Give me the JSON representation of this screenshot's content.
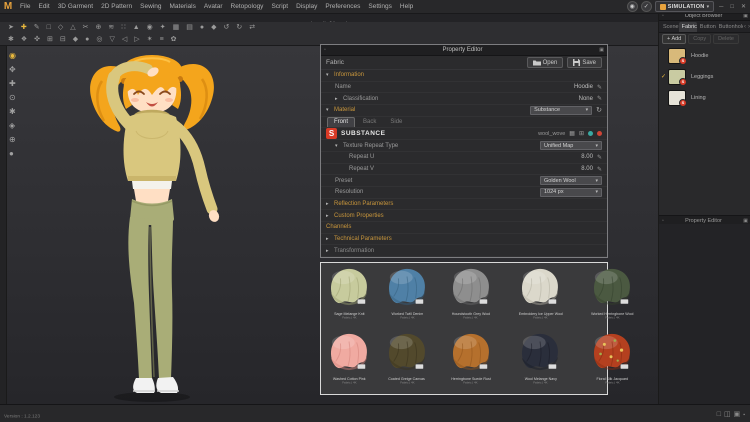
{
  "window": {
    "logo": "M",
    "menus": [
      "File",
      "Edit",
      "3D Garment",
      "2D Pattern",
      "Sewing",
      "Materials",
      "Avatar",
      "Retopology",
      "Script",
      "Display",
      "Preferences",
      "Settings",
      "Help"
    ],
    "document_tab": "hoodie01.zprj",
    "mode_label": "SIMULATION",
    "status_text": "Version : 1.2.123",
    "window_controls": [
      "─",
      "□",
      "✕"
    ],
    "account_icons": [
      {
        "name": "user-icon",
        "glyph": "◉"
      },
      {
        "name": "sync-check-icon",
        "glyph": "✓"
      }
    ]
  },
  "toolbar": {
    "row1": [
      {
        "name": "select-tool-icon",
        "glyph": "➤"
      },
      {
        "name": "add-tool-icon",
        "glyph": "✚"
      },
      {
        "name": "edit-pattern-icon",
        "glyph": "✎"
      },
      {
        "name": "rectangle-tool-icon",
        "glyph": "□"
      },
      {
        "name": "polygon-tool-icon",
        "glyph": "◇"
      },
      {
        "name": "curve-tool-icon",
        "glyph": "△"
      },
      {
        "name": "scissors-icon",
        "glyph": "✂"
      },
      {
        "name": "sew-tool-icon",
        "glyph": "⊕"
      },
      {
        "name": "free-sew-icon",
        "glyph": "≋"
      },
      {
        "name": "pin-tool-icon",
        "glyph": "∷"
      },
      {
        "name": "avatar-tool-icon",
        "glyph": "▲"
      },
      {
        "name": "target-icon",
        "glyph": "◉"
      },
      {
        "name": "sparkle-icon",
        "glyph": "✦"
      },
      {
        "name": "grid-icon",
        "glyph": "▦"
      },
      {
        "name": "layers-icon",
        "glyph": "▤"
      },
      {
        "name": "dot-icon",
        "glyph": "●"
      },
      {
        "name": "diamond-icon",
        "glyph": "◆"
      },
      {
        "name": "undo-icon",
        "glyph": "↺"
      },
      {
        "name": "redo-icon",
        "glyph": "↻"
      },
      {
        "name": "swap-icon",
        "glyph": "⇄"
      }
    ],
    "row2": [
      {
        "name": "asterisk-tool-icon",
        "glyph": "✱"
      },
      {
        "name": "ornament-tool-icon",
        "glyph": "❖"
      },
      {
        "name": "cross-tool-icon",
        "glyph": "✜"
      },
      {
        "name": "add-box-icon",
        "glyph": "⊞"
      },
      {
        "name": "remove-box-icon",
        "glyph": "⊟"
      },
      {
        "name": "solid-diamond-icon",
        "glyph": "◆"
      },
      {
        "name": "solid-dot-icon",
        "glyph": "●"
      },
      {
        "name": "ring-icon",
        "glyph": "◎"
      },
      {
        "name": "down-tri-icon",
        "glyph": "▽"
      },
      {
        "name": "left-tri-icon",
        "glyph": "◁"
      },
      {
        "name": "right-tri-icon",
        "glyph": "▷"
      },
      {
        "name": "star-icon",
        "glyph": "✶"
      },
      {
        "name": "list-icon",
        "glyph": "≡"
      },
      {
        "name": "flower-icon",
        "glyph": "✿"
      }
    ],
    "side": [
      {
        "name": "avatar-pose-icon",
        "glyph": "◉"
      },
      {
        "name": "move-icon",
        "glyph": "✥"
      },
      {
        "name": "add-icon",
        "glyph": "✚"
      },
      {
        "name": "focus-icon",
        "glyph": "⊙"
      },
      {
        "name": "burst-icon",
        "glyph": "✱"
      },
      {
        "name": "gizmo-icon",
        "glyph": "◈"
      },
      {
        "name": "orbit-icon",
        "glyph": "⊕"
      },
      {
        "name": "dot-icon",
        "glyph": "●"
      }
    ]
  },
  "property_editor": {
    "title": "Property Editor",
    "fabric_label": "Fabric",
    "open_label": "Open",
    "save_label": "Save",
    "material_tabs": [
      "Front",
      "Back",
      "Side"
    ],
    "active_tab": "Front",
    "substance_brand": "SUBSTANCE",
    "substance_file": "wool_wove",
    "rows": [
      {
        "type": "section",
        "label": "Information",
        "expanded": true
      },
      {
        "type": "value",
        "label": "Name",
        "value": "Hoodie",
        "indent": 1,
        "editable": true
      },
      {
        "type": "value",
        "label": "Classification",
        "value": "None",
        "indent": 1,
        "arrow": true,
        "editable": true
      },
      {
        "type": "section-dropdown",
        "label": "Material",
        "value": "Substance",
        "expanded": true
      },
      {
        "type": "tabs"
      },
      {
        "type": "brand"
      },
      {
        "type": "dropdown",
        "label": "Texture Repeat Type",
        "value": "Unified Map",
        "indent": 1,
        "expanded": true
      },
      {
        "type": "value",
        "label": "Repeat U",
        "value": "8.00",
        "indent": 2,
        "editable": true
      },
      {
        "type": "value",
        "label": "Repeat V",
        "value": "8.00",
        "indent": 2,
        "editable": true
      },
      {
        "type": "dropdown",
        "label": "Preset",
        "value": "Golden Wool",
        "indent": 1
      },
      {
        "type": "dropdown",
        "label": "Resolution",
        "value": "1024 px",
        "indent": 1
      },
      {
        "type": "section",
        "label": "Reflection Parameters",
        "expanded": false
      },
      {
        "type": "section",
        "label": "Custom Properties",
        "expanded": false
      },
      {
        "type": "plain",
        "label": "Channels"
      },
      {
        "type": "section",
        "label": "Technical Parameters",
        "expanded": false
      },
      {
        "type": "section",
        "label": "Transformation",
        "expanded": false,
        "muted": true
      }
    ]
  },
  "object_browser": {
    "title": "Object Browser",
    "tabs": [
      "Scene",
      "Fabric",
      "Button",
      "Buttonhole"
    ],
    "active_tab": "Fabric",
    "add_label": "Add",
    "copy_label": "Copy",
    "delete_label": "Delete",
    "fabrics": [
      {
        "name": "Hoodie",
        "color": "#d8b97a",
        "checked": false
      },
      {
        "name": "Leggings",
        "color": "#c9cba2",
        "checked": true
      },
      {
        "name": "Lining",
        "color": "#e6e3d8",
        "checked": false
      }
    ],
    "secondary_panel_title": "Property Editor"
  },
  "swatch_gallery": {
    "items": [
      {
        "name": "Sage Melange Knit",
        "sub": "Fabric | 4K",
        "color": "#c7cb9d",
        "shade": "#9da171"
      },
      {
        "name": "Worked Twill Denim",
        "sub": "Fabric | 4K",
        "color": "#4f80a6",
        "shade": "#36607f"
      },
      {
        "name": "Houndstooth Grey Wool",
        "sub": "Fabric | 4K",
        "color": "#8e8e8e",
        "shade": "#6b6b6b"
      },
      {
        "name": "Embroidery Ice Upper Wool",
        "sub": "Fabric | 4K",
        "color": "#dbd8cb",
        "shade": "#b3b0a2"
      },
      {
        "name": "Worked Herringbone Wool",
        "sub": "Fabric | 4K",
        "color": "#4b5941",
        "shade": "#35412d"
      },
      {
        "name": "Washed Cotton Pink",
        "sub": "Fabric | 4K",
        "color": "#f0aaa1",
        "shade": "#d4837b"
      },
      {
        "name": "Coated Greige Canvas",
        "sub": "Fabric | 4K",
        "color": "#52492c",
        "shade": "#39321d"
      },
      {
        "name": "Herringbone Suede Rust",
        "sub": "Fabric | 4K",
        "color": "#b5702d",
        "shade": "#8f541c"
      },
      {
        "name": "Wool Melange Navy",
        "sub": "Fabric | 4K",
        "color": "#2a2e3b",
        "shade": "#191c26"
      },
      {
        "name": "Floral Silk Jacquard",
        "sub": "Fabric | 4K",
        "color": "#b4401f",
        "shade": "#872c11",
        "floral": true
      }
    ]
  }
}
